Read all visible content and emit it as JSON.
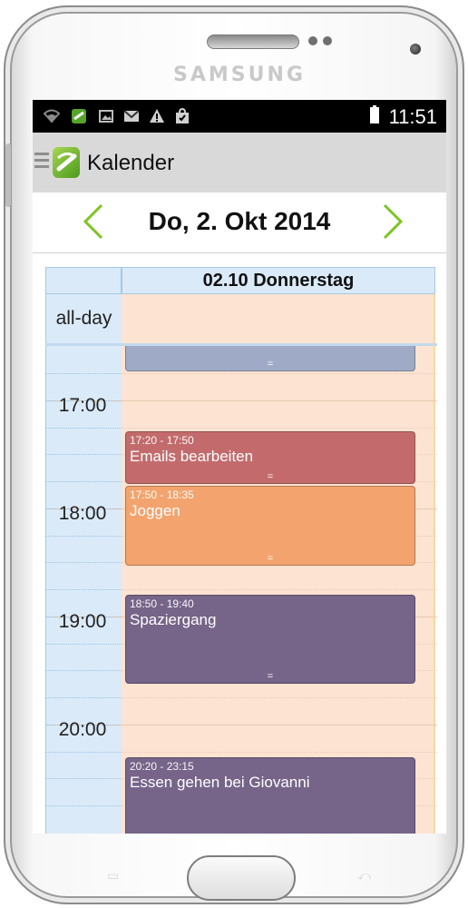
{
  "device": {
    "brand": "SAMSUNG"
  },
  "statusbar": {
    "time": "11:51",
    "icons": [
      "wifi-icon",
      "app-notification-icon",
      "image-icon",
      "mail-icon",
      "warning-icon",
      "shopping-bag-icon",
      "battery-icon"
    ]
  },
  "actionbar": {
    "title": "Kalender",
    "icons": [
      "hamburger-menu-icon",
      "app-logo-icon"
    ]
  },
  "datebar": {
    "title": "Do, 2. Okt 2014"
  },
  "calendar": {
    "column_header": "02.10 Donnerstag",
    "allday_label": "all-day",
    "hours": [
      {
        "label": "17:00"
      },
      {
        "label": "18:00"
      },
      {
        "label": "19:00"
      },
      {
        "label": "20:00"
      }
    ],
    "events": [
      {
        "time": "",
        "title": "",
        "color": "#9fabc6"
      },
      {
        "time": "17:20 - 17:50",
        "title": "Emails bearbeiten",
        "color": "#c36b6c"
      },
      {
        "time": "17:50 - 18:35",
        "title": "Joggen",
        "color": "#f3a36d"
      },
      {
        "time": "18:50 - 19:40",
        "title": "Spaziergang",
        "color": "#766489"
      },
      {
        "time": "20:20 - 23:15",
        "title": "Essen gehen bei Giovanni",
        "color": "#766489"
      }
    ],
    "resize_handle": "="
  },
  "colors": {
    "accent_arrow": "#7dc423",
    "allday_bg": "#fce3d2",
    "gutter_bg": "#daeaf8"
  }
}
